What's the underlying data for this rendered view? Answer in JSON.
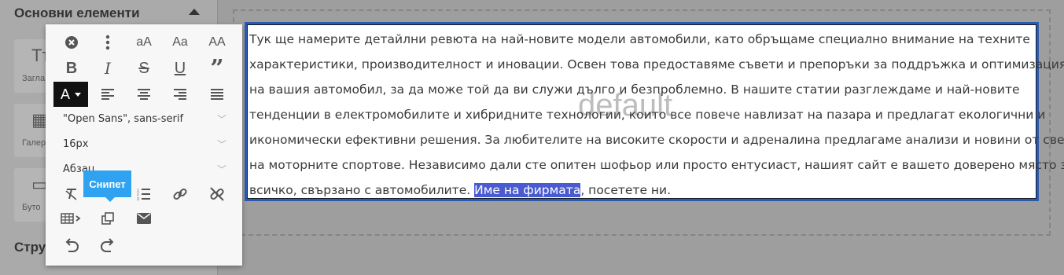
{
  "sidebar": {
    "section_title": "Основни елементи",
    "tiles": [
      {
        "icon": "text-icon",
        "glyph": "Tт",
        "label": "Загла"
      },
      {
        "icon": "gallery-icon",
        "glyph": "▦",
        "label": "Галер"
      },
      {
        "icon": "button-icon",
        "glyph": "▭",
        "label": "Буто"
      }
    ],
    "section2_title": "Стру"
  },
  "canvas": {
    "placeholder_label": "default",
    "text_lines": [
      "Тук ще намерите детайлни ревюта на най-новите модели автомобили, като обръщаме специално внимание на техните",
      "характеристики, производителност и иновации. Освен това предоставяме съвети и препоръки за поддръжка и оптимизация",
      "на вашия автомобил, за да може той да ви служи дълго и безпроблемно. В нашите статии разглеждаме и най-новите",
      "тенденции в електромобилите и хибридните технологии, които все повече навлизат на пазара и предлагат екологични и",
      "икономически ефективни решения. За любителите на високите скорости и адреналина предлагаме анализи и новини от света",
      "на моторните спортове. Независимо дали сте опитен шофьор или просто ентусиаст, нашият сайт е вашето доверено място за"
    ],
    "last_line_before": "всичко, свързано с автомобилите. ",
    "last_line_selected": "Име на фирмата",
    "last_line_after": ", посетете ни."
  },
  "toolbar": {
    "color_button_label": "A",
    "font_family_value": "\"Open Sans\", sans-serif",
    "font_size_value": "16px",
    "block_format_value": "Абзац",
    "tooltip_text": "Снипет",
    "colors": {
      "accent": "#2fa3f2",
      "selection": "#4a5ad0",
      "editor_border": "#2b5bb0"
    }
  }
}
